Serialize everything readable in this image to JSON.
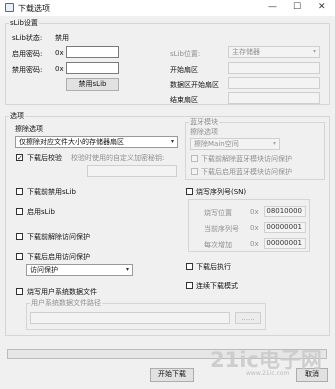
{
  "window": {
    "title": "下载选项",
    "minimize": "—",
    "maximize": "☐",
    "close": "✕"
  },
  "slib": {
    "group_title": "sLib设置",
    "status_label": "sLib状态:",
    "status_value": "禁用",
    "enable_pwd_label": "启用密码:",
    "enable_pwd_prefix": "0x",
    "enable_pwd_value": "",
    "disable_pwd_label": "禁用密码:",
    "disable_pwd_prefix": "0x",
    "disable_pwd_value": "",
    "use_button": "禁用sLib",
    "position_label": "sLib位置:",
    "position_value": "主存储器",
    "start_sector_label": "开始扇区",
    "data_start_label": "数据区开始扇区",
    "end_sector_label": "结束扇区",
    "start_sector_value": "",
    "data_start_value": "",
    "end_sector_value": ""
  },
  "options": {
    "group_title": "选项",
    "erase_group": "擦除选项",
    "erase_value": "仅擦除对应文件大小的存储器扇区",
    "verify_label": "下载后校验",
    "verify_checked": true,
    "verify_pwd_label": "校验时使用的自定义加密秘钥:",
    "bluetooth_group": "蓝牙模块",
    "bt_erase_label": "擦除选项",
    "bt_erase_value": "擦除Main空间",
    "bt_unprotect_label": "下载前解除蓝牙模块访问保护",
    "bt_protect_label": "下载后启用蓝牙模块访问保护",
    "disable_slib_label": "下载前禁用sLib",
    "enable_slib_label": "启用sLib",
    "unprotect_label": "下载前解除访问保护",
    "protect_label": "下载后启用访问保护",
    "protect_value": "访问保护",
    "user_sys_data_label": "烧写用户系统数据文件",
    "user_sys_path_label": "用户系统数据文件路径",
    "user_sys_path_value": "",
    "browse_button": "......",
    "serial_label": "烧写序列号(SN)",
    "serial_pos_label": "烧写位置",
    "serial_pos_prefix": "0x",
    "serial_pos_value": "08010000",
    "serial_cur_label": "当前序列号",
    "serial_cur_prefix": "0x",
    "serial_cur_value": "00000001",
    "serial_inc_label": "每次增加",
    "serial_inc_prefix": "0x",
    "serial_inc_value": "00000001",
    "run_after_label": "下载后执行",
    "continuous_label": "连续下载模式"
  },
  "footer": {
    "start_button": "开始下载",
    "cancel_button": "取消",
    "progress": 0
  },
  "watermark": {
    "text": "21ic电子网",
    "url": "www.21ic.com"
  }
}
